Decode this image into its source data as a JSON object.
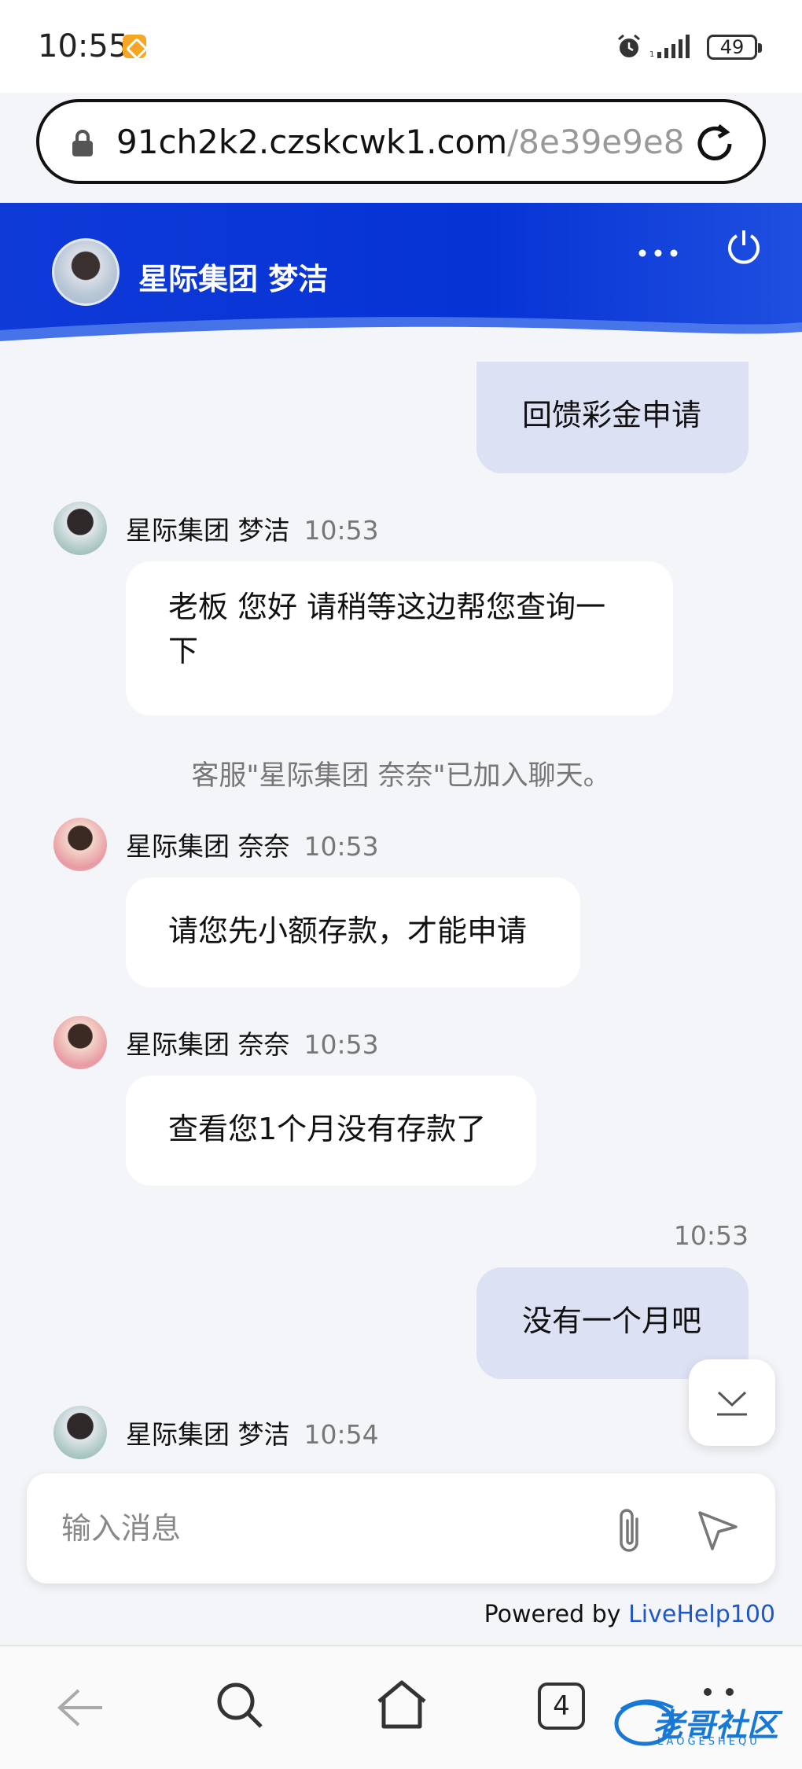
{
  "status_bar": {
    "time": "10:55",
    "battery": "49"
  },
  "browser": {
    "url_host": "91ch2k2.czskcwk1.com",
    "url_path": "/8e39e9e8"
  },
  "chat_header": {
    "title": "星际集团 梦洁"
  },
  "messages": {
    "m1": {
      "text": "回馈彩金申请"
    },
    "m2": {
      "sender": "星际集团 梦洁",
      "time": "10:53",
      "line1": "老板 您好 请稍等这边帮您查询一",
      "line2": "下"
    },
    "system": {
      "text": "客服\"星际集团 奈奈\"已加入聊天。"
    },
    "m3": {
      "sender": "星际集团 奈奈",
      "time": "10:53",
      "text": "请您先小额存款，才能申请"
    },
    "m4": {
      "sender": "星际集团 奈奈",
      "time": "10:53",
      "text": "查看您1个月没有存款了"
    },
    "m5": {
      "time": "10:53",
      "text": "没有一个月吧"
    },
    "m6": {
      "sender": "星际集团 梦洁",
      "time": "10:54"
    }
  },
  "composer": {
    "placeholder": "输入消息"
  },
  "footer": {
    "powered_prefix": "Powered by",
    "powered_brand": "LiveHelp100"
  },
  "nav": {
    "tab_count": "4"
  },
  "watermark": {
    "text": "老哥社区",
    "sub": "LAOGESHEQU"
  },
  "colors": {
    "header_blue": "#0633d4",
    "out_bubble": "#dde1f4",
    "link_blue": "#1f56c8"
  }
}
